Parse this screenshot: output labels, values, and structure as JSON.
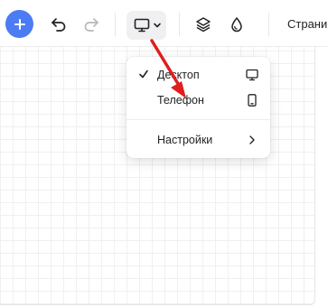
{
  "toolbar": {
    "add_icon": "plus-icon",
    "undo_icon": "undo-icon",
    "redo_icon": "redo-icon",
    "device_icon": "monitor-icon",
    "device_chevron": "chevron-down-icon",
    "layers_icon": "layers-icon",
    "theme_icon": "drop-icon",
    "pages_label": "Страни"
  },
  "device_menu": {
    "items": [
      {
        "label": "Десктоп",
        "icon": "monitor-icon",
        "checked": true
      },
      {
        "label": "Телефон",
        "icon": "phone-icon",
        "checked": false
      }
    ],
    "settings": {
      "label": "Настройки",
      "icon": "chevron-right-icon"
    }
  },
  "colors": {
    "accent": "#4c7cf3",
    "annotation_arrow": "#e01e1e"
  }
}
